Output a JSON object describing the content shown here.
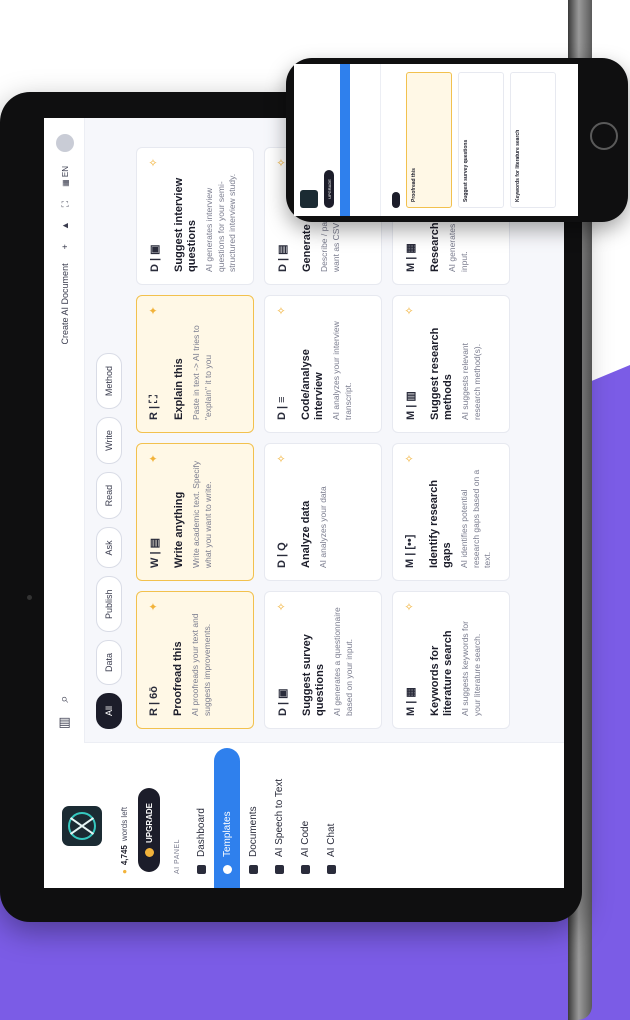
{
  "sidebar": {
    "words_count": "4,745",
    "words_suffix": "words left",
    "upgrade_label": "UPGRADE",
    "section_label": "AI PANEL",
    "items": [
      {
        "label": "Dashboard",
        "icon": "grid-icon"
      },
      {
        "label": "Templates",
        "icon": "template-icon",
        "active": true
      },
      {
        "label": "Documents",
        "icon": "document-icon"
      },
      {
        "label": "AI Speech to Text",
        "icon": "mic-icon"
      },
      {
        "label": "AI Code",
        "icon": "code-icon"
      },
      {
        "label": "AI Chat",
        "icon": "chat-icon"
      }
    ]
  },
  "topbar": {
    "create_label": "Create AI Document",
    "language": "EN"
  },
  "tabs": [
    "All",
    "Data",
    "Publish",
    "Ask",
    "Read",
    "Write",
    "Method"
  ],
  "cards": [
    {
      "badge": "R | 6ō",
      "title": "Proofread this",
      "desc": "AI proofreads your text and suggests improvements.",
      "highlight": true
    },
    {
      "badge": "W | ▤",
      "title": "Write anything",
      "desc": "Write academic text. Specify what you want to write.",
      "highlight": true
    },
    {
      "badge": "R | ⛶",
      "title": "Explain this",
      "desc": "Paste in text -> AI tries to \"explain\" it to you",
      "highlight": true
    },
    {
      "badge": "D | ▣",
      "title": "Suggest interview questions",
      "desc": "AI generates interview questions for your semi-structured interview study.",
      "highlight": false
    },
    {
      "badge": "D | ▣",
      "title": "Suggest survey questions",
      "desc": "AI generates a questionnaire based on your input.",
      "highlight": false
    },
    {
      "badge": "D | Q",
      "title": "Analyze data",
      "desc": "AI analyzes your data",
      "highlight": false
    },
    {
      "badge": "D | ≡",
      "title": "Code/analyse interview",
      "desc": "AI analyzes your interview transcript.",
      "highlight": false
    },
    {
      "badge": "D | ▤",
      "title": "Generate CS",
      "desc": "Describe / paste what you want as CSV",
      "highlight": false
    },
    {
      "badge": "M | ▦",
      "title": "Keywords for literature search",
      "desc": "AI suggests keywords for your literature search.",
      "highlight": false
    },
    {
      "badge": "M | [••]",
      "title": "Identify research gaps",
      "desc": "AI identifies potential research gaps based on a text.",
      "highlight": false
    },
    {
      "badge": "M | ▥",
      "title": "Suggest research methods",
      "desc": "AI suggests relevant research method(s).",
      "highlight": false
    },
    {
      "badge": "M | ▦",
      "title": "Research qu",
      "desc": "AI generates questions bas input.",
      "highlight": false
    }
  ],
  "phone": {
    "card_titles": [
      "Proofread this",
      "Suggest survey questions",
      "Keywords for literature search"
    ]
  }
}
